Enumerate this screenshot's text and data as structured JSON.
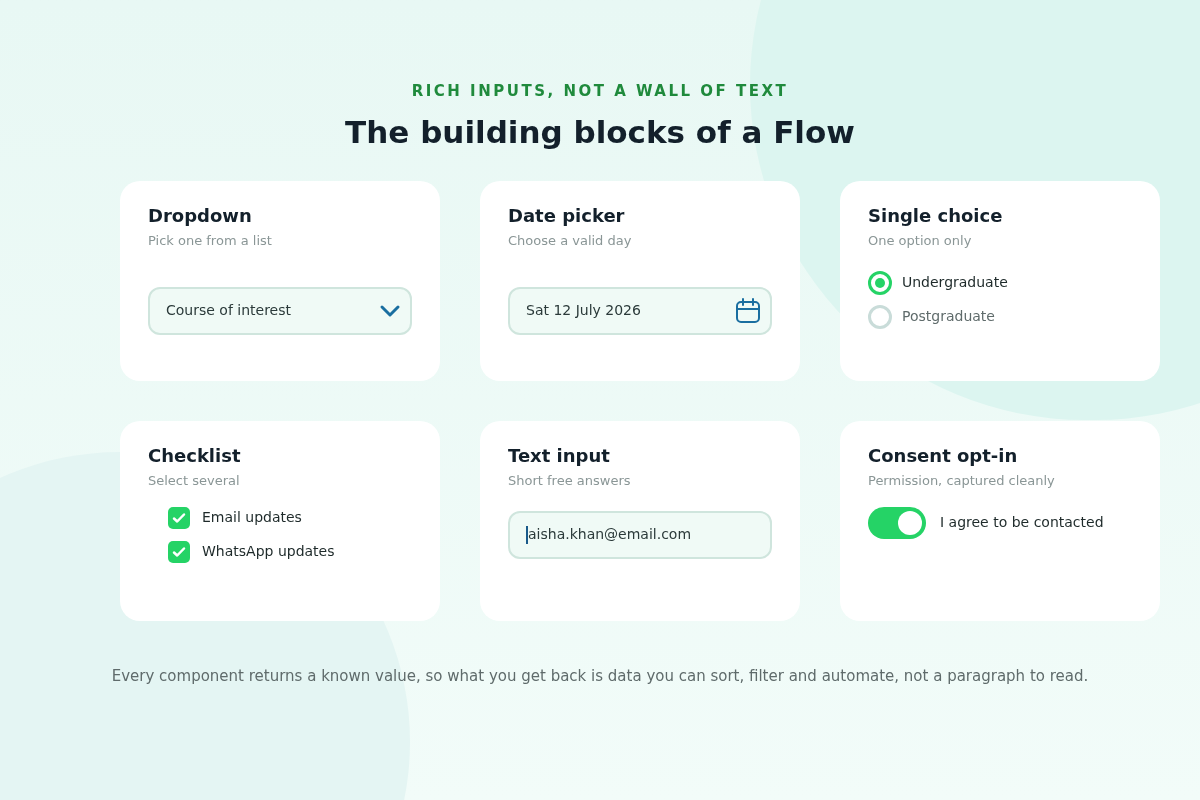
{
  "eyebrow": "RICH INPUTS, NOT A WALL OF TEXT",
  "title": "The building blocks of a Flow",
  "cards": [
    {
      "kind": "dropdown",
      "title": "Dropdown",
      "subtitle": "Pick one from a list",
      "value": "Course of interest"
    },
    {
      "kind": "date",
      "title": "Date picker",
      "subtitle": "Choose a valid day",
      "value": "Sat 12 July 2026"
    },
    {
      "kind": "radio",
      "title": "Single choice",
      "subtitle": "One option only",
      "options": [
        {
          "label": "Undergraduate",
          "selected": true
        },
        {
          "label": "Postgraduate",
          "selected": false
        }
      ]
    },
    {
      "kind": "checklist",
      "title": "Checklist",
      "subtitle": "Select several",
      "options": [
        {
          "label": "Email updates",
          "checked": true
        },
        {
          "label": "WhatsApp updates",
          "checked": true
        }
      ]
    },
    {
      "kind": "text",
      "title": "Text input",
      "subtitle": "Short free answers",
      "value": "aisha.khan@email.com",
      "focused": true
    },
    {
      "kind": "toggle",
      "title": "Consent opt-in",
      "subtitle": "Permission, captured cleanly",
      "label": "I agree to be contacted",
      "on": true
    }
  ],
  "footer": "Every component returns a known value, so what you get back is data you can sort, filter and automate, not a paragraph to read."
}
